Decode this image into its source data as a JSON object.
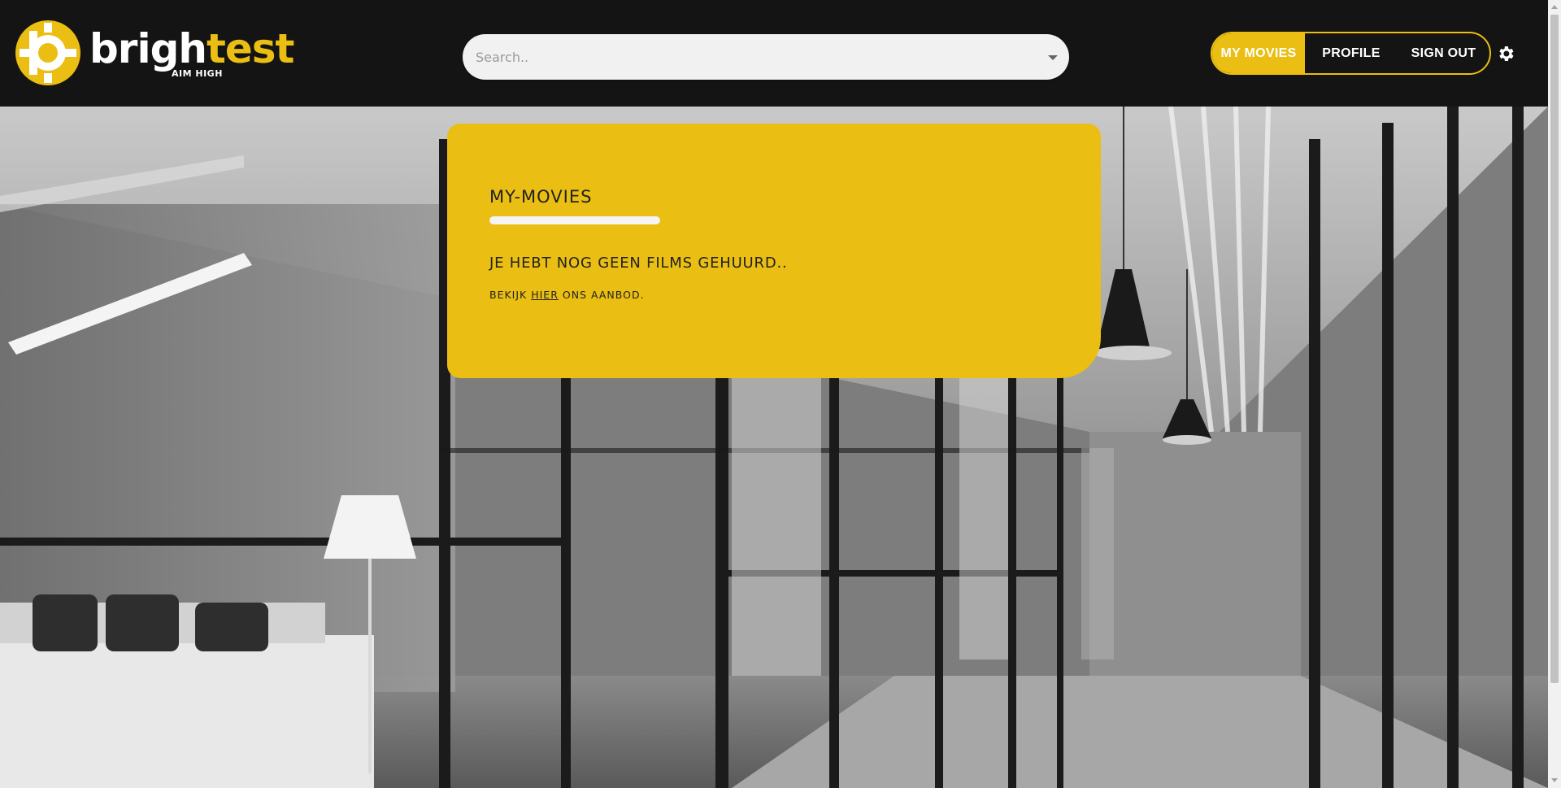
{
  "header": {
    "logo": {
      "name": "brightest",
      "name_white": "brigh",
      "name_yellow": "test",
      "tagline": "AIM HIGH"
    },
    "search": {
      "placeholder": "Search.."
    },
    "nav": {
      "items": [
        {
          "label": "MY MOVIES",
          "active": true
        },
        {
          "label": "PROFILE",
          "active": false
        },
        {
          "label": "SIGN OUT",
          "active": false
        }
      ]
    },
    "settings_icon": "gear-icon"
  },
  "card": {
    "title": "MY-MOVIES",
    "message": "JE HEBT NOG GEEN FILMS GEHUURD..",
    "sub_prefix": "BEKIJK ",
    "sub_link": "HIER",
    "sub_suffix": " ONS AANBOD."
  },
  "colors": {
    "accent": "#eabe12",
    "header_bg": "#141414",
    "card_text": "#222222"
  }
}
